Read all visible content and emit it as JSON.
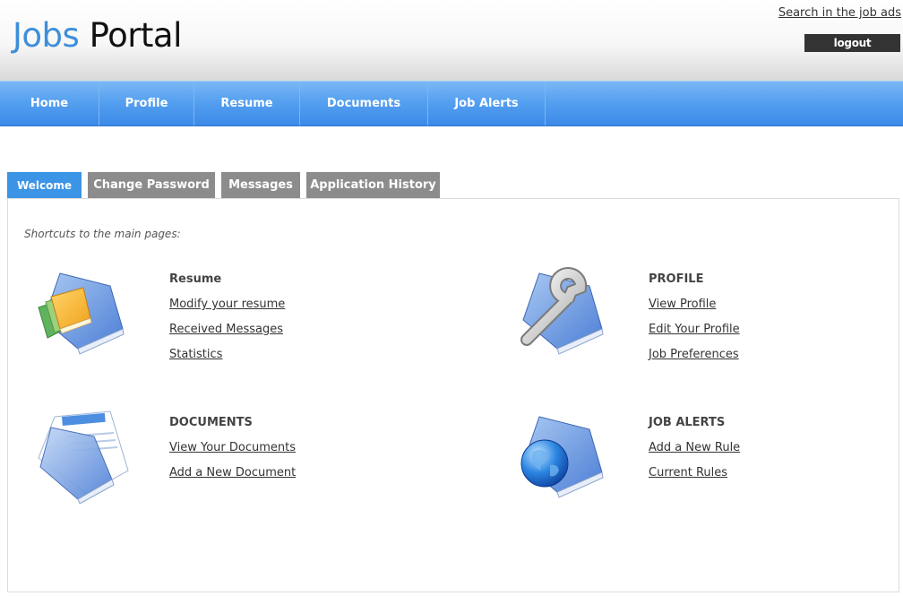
{
  "header": {
    "logo_first": "Jobs",
    "logo_second": "Portal",
    "search_link": "Search in the job ads",
    "logout_label": "logout"
  },
  "nav": {
    "items": [
      {
        "label": "Home"
      },
      {
        "label": "Profile"
      },
      {
        "label": "Resume"
      },
      {
        "label": "Documents"
      },
      {
        "label": "Job Alerts"
      }
    ]
  },
  "tabs": [
    {
      "label": "Welcome",
      "active": true
    },
    {
      "label": "Change Password",
      "active": false
    },
    {
      "label": "Messages",
      "active": false
    },
    {
      "label": "Application History",
      "active": false
    }
  ],
  "panel": {
    "intro": "Shortcuts to the main pages:",
    "sections": [
      {
        "title": "Resume",
        "icon": "books-icon",
        "links": [
          "Modify your resume",
          "Received Messages",
          "Statistics"
        ]
      },
      {
        "title": "PROFILE",
        "icon": "wrench-book-icon",
        "links": [
          "View Profile",
          "Edit Your Profile",
          "Job Preferences"
        ]
      },
      {
        "title": "DOCUMENTS",
        "icon": "document-book-icon",
        "links": [
          "View Your Documents",
          "Add a New Document"
        ]
      },
      {
        "title": "JOB ALERTS",
        "icon": "globe-book-icon",
        "links": [
          "Add a New Rule",
          "Current Rules"
        ]
      }
    ]
  },
  "colors": {
    "brand_blue": "#3d8fd9",
    "nav_blue": "#4a96ec",
    "tab_active": "#3b94e6",
    "tab_inactive": "#8c8c8c",
    "logout_bg": "#333333"
  }
}
